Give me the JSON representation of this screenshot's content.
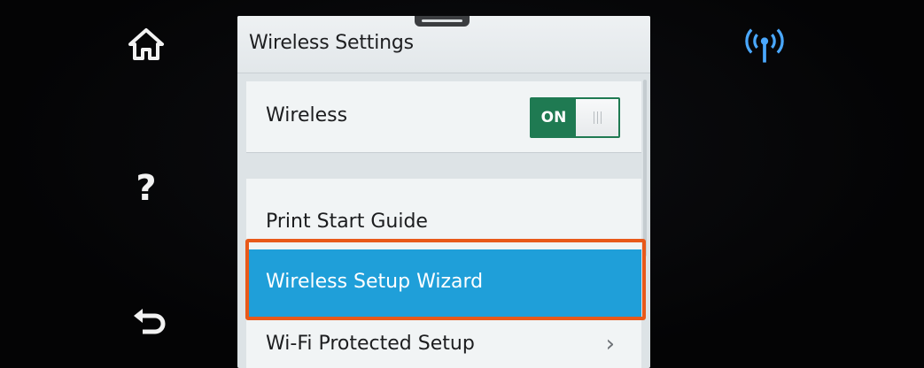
{
  "side_buttons": {
    "home_icon": "home-icon",
    "help_label": "?",
    "back_icon": "back-icon"
  },
  "status": {
    "wireless_icon": "wireless-signal-icon",
    "wireless_color": "#4aa8ff"
  },
  "screen": {
    "title": "Wireless Settings",
    "items": [
      {
        "label": "Wireless",
        "toggle": "ON"
      },
      {
        "label": "Print Start Guide"
      },
      {
        "label": "Wireless Setup Wizard",
        "selected": true
      },
      {
        "label": "Wi-Fi Protected Setup"
      }
    ],
    "selected_color": "#1f9fd9",
    "highlight_color": "#e8591a",
    "toggle_color": "#1f7a52"
  }
}
